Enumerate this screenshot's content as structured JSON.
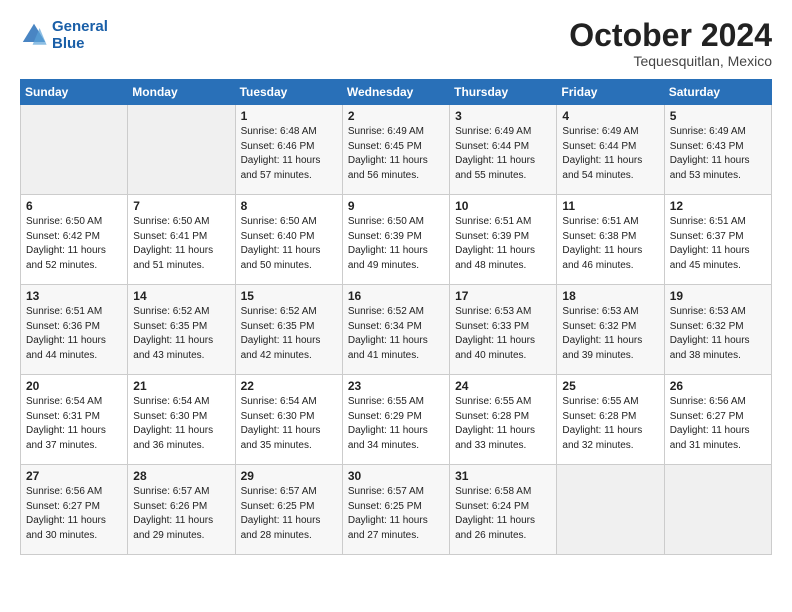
{
  "header": {
    "logo_line1": "General",
    "logo_line2": "Blue",
    "month_title": "October 2024",
    "subtitle": "Tequesquitlan, Mexico"
  },
  "weekdays": [
    "Sunday",
    "Monday",
    "Tuesday",
    "Wednesday",
    "Thursday",
    "Friday",
    "Saturday"
  ],
  "weeks": [
    [
      {
        "day": "",
        "sunrise": "",
        "sunset": "",
        "daylight": ""
      },
      {
        "day": "",
        "sunrise": "",
        "sunset": "",
        "daylight": ""
      },
      {
        "day": "1",
        "sunrise": "Sunrise: 6:48 AM",
        "sunset": "Sunset: 6:46 PM",
        "daylight": "Daylight: 11 hours and 57 minutes."
      },
      {
        "day": "2",
        "sunrise": "Sunrise: 6:49 AM",
        "sunset": "Sunset: 6:45 PM",
        "daylight": "Daylight: 11 hours and 56 minutes."
      },
      {
        "day": "3",
        "sunrise": "Sunrise: 6:49 AM",
        "sunset": "Sunset: 6:44 PM",
        "daylight": "Daylight: 11 hours and 55 minutes."
      },
      {
        "day": "4",
        "sunrise": "Sunrise: 6:49 AM",
        "sunset": "Sunset: 6:44 PM",
        "daylight": "Daylight: 11 hours and 54 minutes."
      },
      {
        "day": "5",
        "sunrise": "Sunrise: 6:49 AM",
        "sunset": "Sunset: 6:43 PM",
        "daylight": "Daylight: 11 hours and 53 minutes."
      }
    ],
    [
      {
        "day": "6",
        "sunrise": "Sunrise: 6:50 AM",
        "sunset": "Sunset: 6:42 PM",
        "daylight": "Daylight: 11 hours and 52 minutes."
      },
      {
        "day": "7",
        "sunrise": "Sunrise: 6:50 AM",
        "sunset": "Sunset: 6:41 PM",
        "daylight": "Daylight: 11 hours and 51 minutes."
      },
      {
        "day": "8",
        "sunrise": "Sunrise: 6:50 AM",
        "sunset": "Sunset: 6:40 PM",
        "daylight": "Daylight: 11 hours and 50 minutes."
      },
      {
        "day": "9",
        "sunrise": "Sunrise: 6:50 AM",
        "sunset": "Sunset: 6:39 PM",
        "daylight": "Daylight: 11 hours and 49 minutes."
      },
      {
        "day": "10",
        "sunrise": "Sunrise: 6:51 AM",
        "sunset": "Sunset: 6:39 PM",
        "daylight": "Daylight: 11 hours and 48 minutes."
      },
      {
        "day": "11",
        "sunrise": "Sunrise: 6:51 AM",
        "sunset": "Sunset: 6:38 PM",
        "daylight": "Daylight: 11 hours and 46 minutes."
      },
      {
        "day": "12",
        "sunrise": "Sunrise: 6:51 AM",
        "sunset": "Sunset: 6:37 PM",
        "daylight": "Daylight: 11 hours and 45 minutes."
      }
    ],
    [
      {
        "day": "13",
        "sunrise": "Sunrise: 6:51 AM",
        "sunset": "Sunset: 6:36 PM",
        "daylight": "Daylight: 11 hours and 44 minutes."
      },
      {
        "day": "14",
        "sunrise": "Sunrise: 6:52 AM",
        "sunset": "Sunset: 6:35 PM",
        "daylight": "Daylight: 11 hours and 43 minutes."
      },
      {
        "day": "15",
        "sunrise": "Sunrise: 6:52 AM",
        "sunset": "Sunset: 6:35 PM",
        "daylight": "Daylight: 11 hours and 42 minutes."
      },
      {
        "day": "16",
        "sunrise": "Sunrise: 6:52 AM",
        "sunset": "Sunset: 6:34 PM",
        "daylight": "Daylight: 11 hours and 41 minutes."
      },
      {
        "day": "17",
        "sunrise": "Sunrise: 6:53 AM",
        "sunset": "Sunset: 6:33 PM",
        "daylight": "Daylight: 11 hours and 40 minutes."
      },
      {
        "day": "18",
        "sunrise": "Sunrise: 6:53 AM",
        "sunset": "Sunset: 6:32 PM",
        "daylight": "Daylight: 11 hours and 39 minutes."
      },
      {
        "day": "19",
        "sunrise": "Sunrise: 6:53 AM",
        "sunset": "Sunset: 6:32 PM",
        "daylight": "Daylight: 11 hours and 38 minutes."
      }
    ],
    [
      {
        "day": "20",
        "sunrise": "Sunrise: 6:54 AM",
        "sunset": "Sunset: 6:31 PM",
        "daylight": "Daylight: 11 hours and 37 minutes."
      },
      {
        "day": "21",
        "sunrise": "Sunrise: 6:54 AM",
        "sunset": "Sunset: 6:30 PM",
        "daylight": "Daylight: 11 hours and 36 minutes."
      },
      {
        "day": "22",
        "sunrise": "Sunrise: 6:54 AM",
        "sunset": "Sunset: 6:30 PM",
        "daylight": "Daylight: 11 hours and 35 minutes."
      },
      {
        "day": "23",
        "sunrise": "Sunrise: 6:55 AM",
        "sunset": "Sunset: 6:29 PM",
        "daylight": "Daylight: 11 hours and 34 minutes."
      },
      {
        "day": "24",
        "sunrise": "Sunrise: 6:55 AM",
        "sunset": "Sunset: 6:28 PM",
        "daylight": "Daylight: 11 hours and 33 minutes."
      },
      {
        "day": "25",
        "sunrise": "Sunrise: 6:55 AM",
        "sunset": "Sunset: 6:28 PM",
        "daylight": "Daylight: 11 hours and 32 minutes."
      },
      {
        "day": "26",
        "sunrise": "Sunrise: 6:56 AM",
        "sunset": "Sunset: 6:27 PM",
        "daylight": "Daylight: 11 hours and 31 minutes."
      }
    ],
    [
      {
        "day": "27",
        "sunrise": "Sunrise: 6:56 AM",
        "sunset": "Sunset: 6:27 PM",
        "daylight": "Daylight: 11 hours and 30 minutes."
      },
      {
        "day": "28",
        "sunrise": "Sunrise: 6:57 AM",
        "sunset": "Sunset: 6:26 PM",
        "daylight": "Daylight: 11 hours and 29 minutes."
      },
      {
        "day": "29",
        "sunrise": "Sunrise: 6:57 AM",
        "sunset": "Sunset: 6:25 PM",
        "daylight": "Daylight: 11 hours and 28 minutes."
      },
      {
        "day": "30",
        "sunrise": "Sunrise: 6:57 AM",
        "sunset": "Sunset: 6:25 PM",
        "daylight": "Daylight: 11 hours and 27 minutes."
      },
      {
        "day": "31",
        "sunrise": "Sunrise: 6:58 AM",
        "sunset": "Sunset: 6:24 PM",
        "daylight": "Daylight: 11 hours and 26 minutes."
      },
      {
        "day": "",
        "sunrise": "",
        "sunset": "",
        "daylight": ""
      },
      {
        "day": "",
        "sunrise": "",
        "sunset": "",
        "daylight": ""
      }
    ]
  ]
}
